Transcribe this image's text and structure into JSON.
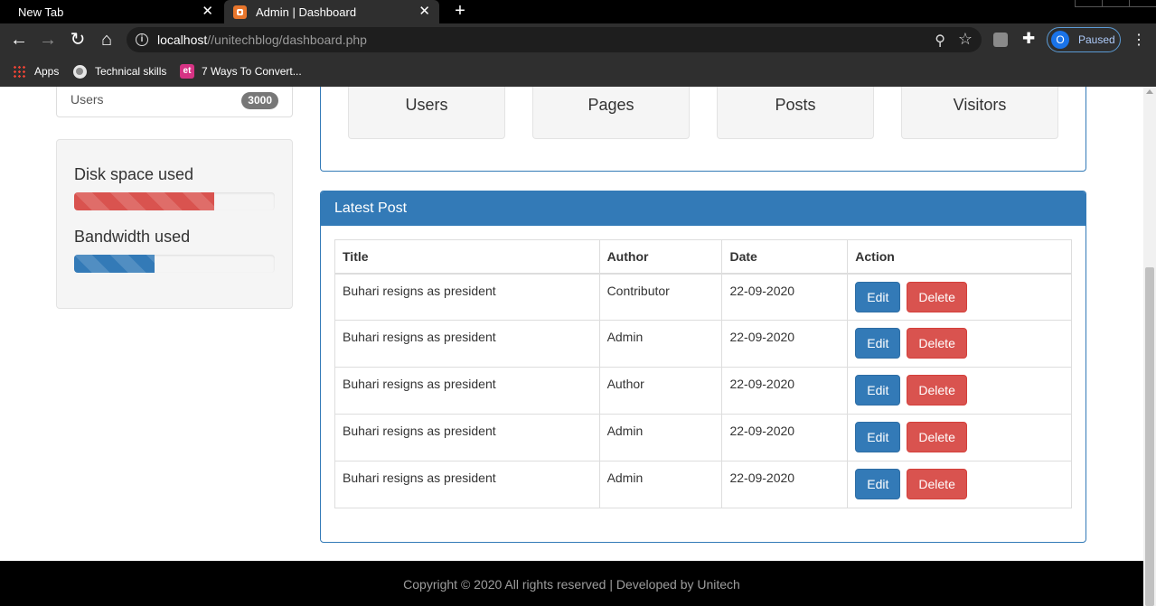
{
  "browser": {
    "tabs": [
      {
        "label": "New Tab",
        "active": false
      },
      {
        "label": "Admin | Dashboard",
        "active": true
      }
    ],
    "url_host": "localhost",
    "url_path": "//unitechblog/dashboard.php",
    "profile_initial": "O",
    "profile_status": "Paused",
    "bookmarks": [
      {
        "label": "Apps",
        "icon": "apps-grid-icon"
      },
      {
        "label": "Technical skills",
        "icon": "globe-icon"
      },
      {
        "label": "7 Ways To Convert...",
        "icon": "et-icon"
      }
    ]
  },
  "sidebar": {
    "users_label": "Users",
    "users_count": "3000",
    "disk_label": "Disk space used",
    "disk_fraction": 0.7,
    "bandwidth_label": "Bandwidth used",
    "bandwidth_fraction": 0.4
  },
  "overview": {
    "stats": [
      "Users",
      "Pages",
      "Posts",
      "Visitors"
    ]
  },
  "latest_post": {
    "heading": "Latest Post",
    "columns": [
      "Title",
      "Author",
      "Date",
      "Action"
    ],
    "rows": [
      {
        "title": "Buhari resigns as president",
        "author": "Contributor",
        "date": "22-09-2020"
      },
      {
        "title": "Buhari resigns as president",
        "author": "Admin",
        "date": "22-09-2020"
      },
      {
        "title": "Buhari resigns as president",
        "author": "Author",
        "date": "22-09-2020"
      },
      {
        "title": "Buhari resigns as president",
        "author": "Admin",
        "date": "22-09-2020"
      },
      {
        "title": "Buhari resigns as president",
        "author": "Admin",
        "date": "22-09-2020"
      }
    ],
    "edit_label": "Edit",
    "delete_label": "Delete"
  },
  "footer": {
    "text": "Copyright © 2020 All rights reserved | Developed by Unitech"
  },
  "colors": {
    "primary": "#337ab7",
    "danger": "#d9534f",
    "footer_bg": "#000000"
  }
}
